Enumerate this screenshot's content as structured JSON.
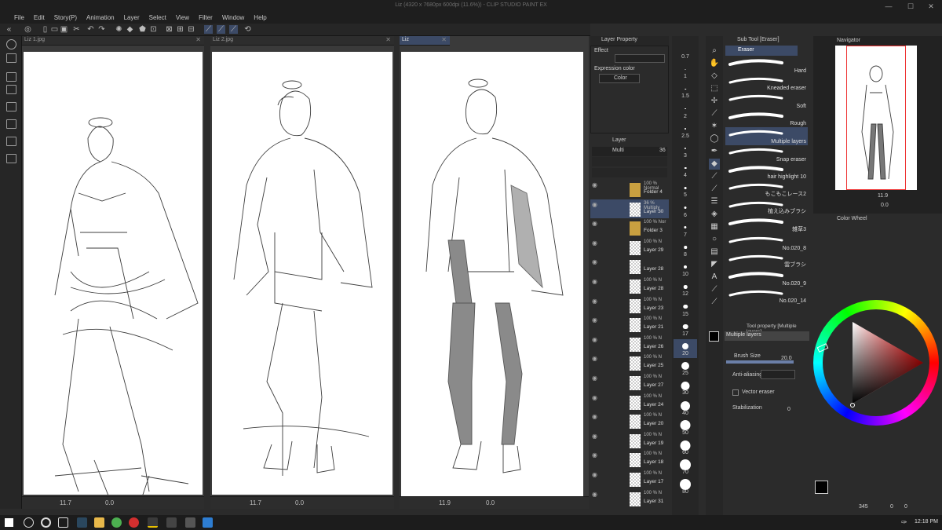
{
  "window": {
    "title": "Liz (4320 x 7680px 600dpi (11.6%)) - CLIP STUDIO PAINT EX",
    "minimize": "—",
    "maximize": "☐",
    "close": "✕"
  },
  "menu": [
    "File",
    "Edit",
    "Story(P)",
    "Animation",
    "Layer",
    "Select",
    "View",
    "Filter",
    "Window",
    "Help"
  ],
  "canvases": [
    {
      "tab": "Liz 1.jpg",
      "zoom": "11.7",
      "rotate": "0.0"
    },
    {
      "tab": "Liz 2.jpg",
      "zoom": "11.7",
      "rotate": "0.0"
    },
    {
      "tab": "Liz",
      "zoom": "11.9",
      "rotate": "0.0"
    }
  ],
  "layer_property": {
    "tab": "Layer Property",
    "effect_label": "Effect",
    "expression_label": "Expression color",
    "expression_value": "Color"
  },
  "layer_panel": {
    "title": "Layer",
    "blend": "Multi",
    "opacity": "36",
    "rows": [
      {
        "t1": "100 % Normal",
        "t2": "Folder 4",
        "kind": "folder"
      },
      {
        "t1": "36 % Multiply",
        "t2": "Layer 30",
        "kind": "selected"
      },
      {
        "t1": "100 % Nor",
        "t2": "Folder 3",
        "kind": "folder"
      },
      {
        "t1": "100 % N",
        "t2": "Layer 29",
        "kind": "layer"
      },
      {
        "t1": "",
        "t2": "Layer 28",
        "kind": "layer"
      },
      {
        "t1": "100 % N",
        "t2": "Layer 28",
        "kind": "layer"
      },
      {
        "t1": "100 % N",
        "t2": "Layer 23",
        "kind": "layer"
      },
      {
        "t1": "100 % N",
        "t2": "Layer 21",
        "kind": "layer"
      },
      {
        "t1": "100 % N",
        "t2": "Layer 26",
        "kind": "layer"
      },
      {
        "t1": "100 % N",
        "t2": "Layer 25",
        "kind": "layer"
      },
      {
        "t1": "100 % N",
        "t2": "Layer 27",
        "kind": "layer"
      },
      {
        "t1": "100 % N",
        "t2": "Layer 24",
        "kind": "layer"
      },
      {
        "t1": "100 % N",
        "t2": "Layer 20",
        "kind": "layer"
      },
      {
        "t1": "100 % N",
        "t2": "Layer 19",
        "kind": "layer"
      },
      {
        "t1": "100 % N",
        "t2": "Layer 18",
        "kind": "layer"
      },
      {
        "t1": "100 % N",
        "t2": "Layer 17",
        "kind": "layer"
      },
      {
        "t1": "100 % N",
        "t2": "Layer 31",
        "kind": "layer"
      }
    ]
  },
  "brush_sizes": [
    {
      "label": "0.7",
      "d": 0
    },
    {
      "label": "1",
      "d": 1
    },
    {
      "label": "1.5",
      "d": 1.5
    },
    {
      "label": "2",
      "d": 1.8
    },
    {
      "label": "2.5",
      "d": 2
    },
    {
      "label": "3",
      "d": 2.2
    },
    {
      "label": "4",
      "d": 2.5
    },
    {
      "label": "5",
      "d": 2.8
    },
    {
      "label": "6",
      "d": 3
    },
    {
      "label": "7",
      "d": 3.2
    },
    {
      "label": "8",
      "d": 3.5
    },
    {
      "label": "10",
      "d": 4
    },
    {
      "label": "12",
      "d": 4.5
    },
    {
      "label": "15",
      "d": 5.5
    },
    {
      "label": "17",
      "d": 6.5
    },
    {
      "label": "20",
      "d": 8
    },
    {
      "label": "25",
      "d": 10
    },
    {
      "label": "30",
      "d": 11
    },
    {
      "label": "40",
      "d": 12
    },
    {
      "label": "50",
      "d": 13
    },
    {
      "label": "60",
      "d": 13
    },
    {
      "label": "70",
      "d": 14
    },
    {
      "label": "80",
      "d": 14
    }
  ],
  "sub_tool": {
    "tab": "Sub Tool [Eraser]",
    "header": "Eraser",
    "brushes": [
      "Hard",
      "Kneaded eraser",
      "Soft",
      "Rough",
      "Multiple layers",
      "Snap eraser",
      "hair highlight 10",
      "もこもこレース2",
      "植え込みブラシ",
      "雑草3",
      "No.020_8",
      "雲ブラシ",
      "No.020_9",
      "No.020_14"
    ]
  },
  "tool_property": {
    "tab": "Tool property [Multiple layers]",
    "preset": "Multiple layers",
    "brush_size_label": "Brush Size",
    "brush_size_value": "20.0",
    "antialias_label": "Anti-aliasing",
    "vector_label": "Vector eraser",
    "stabilization_label": "Stabilization",
    "stabilization_value": "0"
  },
  "navigator": {
    "title": "Navigator",
    "zoom": "11.9",
    "rotate": "0.0"
  },
  "color_wheel": {
    "title": "Color Wheel",
    "coords": "345",
    "coord2": "0",
    "coord3": "0"
  },
  "taskbar": {
    "time": "12:18 PM"
  }
}
